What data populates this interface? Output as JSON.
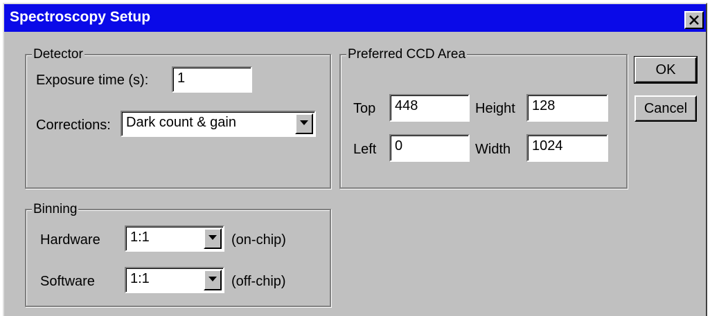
{
  "window": {
    "title": "Spectroscopy Setup"
  },
  "detector": {
    "legend": "Detector",
    "exposure_label": "Exposure time (s):",
    "exposure_value": "1",
    "corrections_label": "Corrections:",
    "corrections_value": "Dark count & gain"
  },
  "ccd": {
    "legend": "Preferred CCD Area",
    "top_label": "Top",
    "top_value": "448",
    "height_label": "Height",
    "height_value": "128",
    "left_label": "Left",
    "left_value": "0",
    "width_label": "Width",
    "width_value": "1024"
  },
  "binning": {
    "legend": "Binning",
    "hardware_label": "Hardware",
    "hardware_value": "1:1",
    "hardware_note": "(on-chip)",
    "software_label": "Software",
    "software_value": "1:1",
    "software_note": "(off-chip)"
  },
  "buttons": {
    "ok": "OK",
    "cancel": "Cancel"
  },
  "colors": {
    "titlebar": "#0a0ae8",
    "face": "#c0c0c0"
  },
  "icons": {
    "close": "close-icon",
    "dropdown": "chevron-down-icon"
  }
}
